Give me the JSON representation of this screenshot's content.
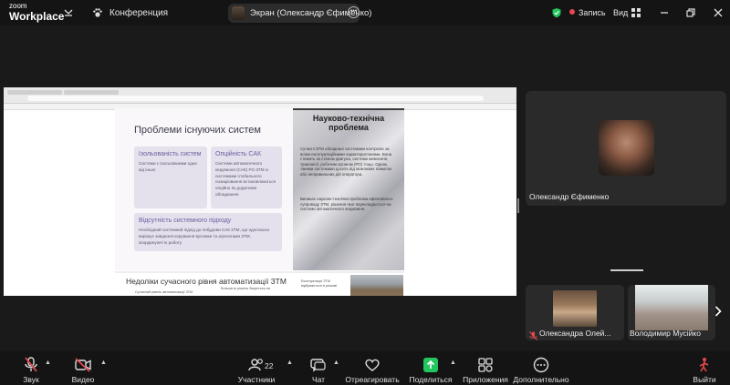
{
  "app": {
    "logo_line1": "zoom",
    "logo_line2": "Workplace",
    "conference_label": "Конференция"
  },
  "screen_share": {
    "label": "Экран (Олександр Єфименко)"
  },
  "topbar": {
    "record_label": "Запись",
    "view_label": "Вид"
  },
  "slide": {
    "title": "Проблеми існуючих систем",
    "cards": [
      {
        "title": "Ізольованість систем",
        "body": "Системи є ізольованими одна від іншої"
      },
      {
        "title": "Опційність САК",
        "body": "Системи автоматичного керування (САК) РО ЗТМ із системами глобального позиціювання встановлюються опційно як додаткове обладнання"
      },
      {
        "title": "Відсутність системного підходу",
        "body": "Необхідний системний підхід до побудови САК ЗТМ, що одночасно вирішує завдання керування вузлами та агрегатами ЗТМ, координуючі їх роботу"
      }
    ],
    "right_title": "Науково-технічна проблема",
    "right_p1": "Сучасні ЗТМ обладнані системами контролю за всіма експлуатаційними характеристиками. Вона стежить за станом двигуна, системи живлення, трансмісії, робочим органом (РО) тощо. Однак, такими системами досить від можливих помилок або неправильних дій оператора.",
    "right_p2": "Виникає науково-технічна проблема ефективного супроводу ЗТМ, рішення якої перекладається на системи автоматичного керування.",
    "slide2_title": "Недоліки сучасного рівня автоматизації ЗТМ",
    "slide2_sub1": "Сучасний рівень автоматизації ЗТМ",
    "slide2_sub2": "Більшість рішень базується на",
    "slide2_sub3": "Експлуатація ЗТМ відбувається в режимі"
  },
  "participants": {
    "main": {
      "name": "Олександр Єфименко"
    },
    "tile1": {
      "name": "Олександра Олей..."
    },
    "tile2": {
      "name": "Володимир Мусійко"
    }
  },
  "toolbar": {
    "audio": "Звук",
    "video": "Видео",
    "participants": "Участники",
    "participants_count": "22",
    "chat": "Чат",
    "react": "Отреагировать",
    "share": "Поделиться",
    "apps": "Приложения",
    "more": "Дополнительно",
    "leave": "Выйти"
  },
  "colors": {
    "accent_green": "#22c55e",
    "record_red": "#e5484d",
    "leave_red": "#e5484d",
    "mute_red": "#e5484d"
  }
}
